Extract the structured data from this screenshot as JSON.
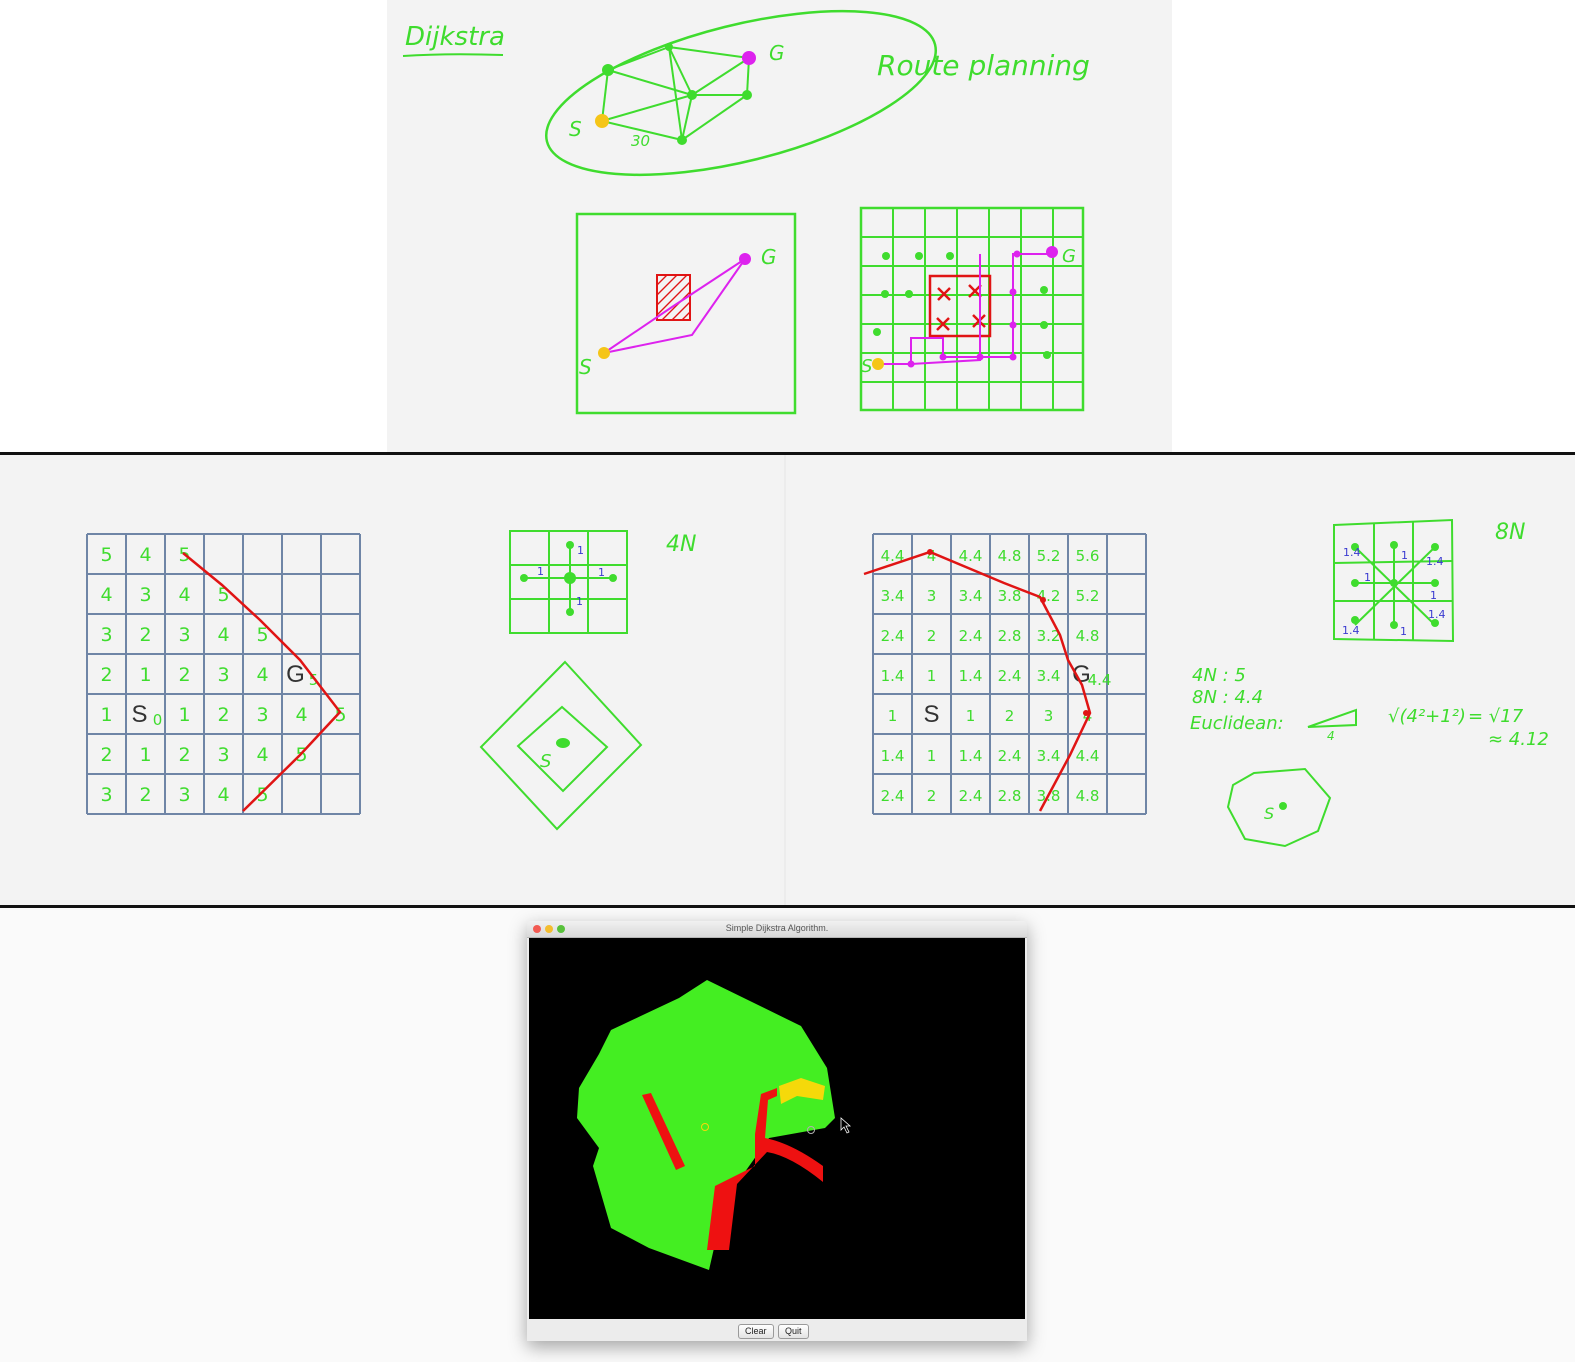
{
  "top_panel": {
    "title": "Dijkstra",
    "heading": "Route planning",
    "graph_labels": {
      "start": "S",
      "goal": "G",
      "edge_weight": "30"
    },
    "obstacle_labels": {
      "start": "S",
      "goal": "G"
    },
    "grid_labels": {
      "start": "S",
      "goal": "G"
    }
  },
  "middle_panel": {
    "four_n": {
      "label": "4N",
      "grid": [
        [
          "5",
          "4",
          "5",
          "",
          "",
          "",
          ""
        ],
        [
          "4",
          "3",
          "4",
          "5",
          "",
          "",
          ""
        ],
        [
          "3",
          "2",
          "3",
          "4",
          "5",
          "",
          ""
        ],
        [
          "2",
          "1",
          "2",
          "3",
          "4",
          "G5",
          ""
        ],
        [
          "1",
          "S0",
          "1",
          "2",
          "3",
          "4",
          "5"
        ],
        [
          "2",
          "1",
          "2",
          "3",
          "4",
          "5",
          ""
        ],
        [
          "3",
          "2",
          "3",
          "4",
          "5",
          "",
          ""
        ]
      ],
      "start_label": "S",
      "goal_label": "G",
      "neighbor_weight": "1",
      "diamond_label": "S"
    },
    "eight_n": {
      "label": "8N",
      "grid": [
        [
          "4.4",
          "4",
          "4.4",
          "4.8",
          "5.2",
          "5.6",
          ""
        ],
        [
          "3.4",
          "3",
          "3.4",
          "3.8",
          "4.2",
          "5.2",
          ""
        ],
        [
          "2.4",
          "2",
          "2.4",
          "2.8",
          "3.2",
          "4.8",
          ""
        ],
        [
          "1.4",
          "1",
          "1.4",
          "2.4",
          "3.4",
          "G4.4",
          ""
        ],
        [
          "1",
          "S",
          "1",
          "2",
          "3",
          "4",
          ""
        ],
        [
          "1.4",
          "1",
          "1.4",
          "2.4",
          "3.4",
          "4.4",
          ""
        ],
        [
          "2.4",
          "2",
          "2.4",
          "2.8",
          "3.8",
          "4.8",
          ""
        ]
      ],
      "start_label": "S",
      "goal_label": "G",
      "diag_weight": "1.4",
      "straight_weight": "1",
      "notes": [
        "4N : 5",
        "8N : 4.4",
        "Euclidean:"
      ],
      "triangle_base": "4",
      "formula_left": "√(4²+1²)",
      "formula_eq": "= √17",
      "formula_approx": "≈ 4.12",
      "octagon_label": "S"
    }
  },
  "app_window": {
    "title": "Simple Dijkstra Algorithm.",
    "buttons": {
      "clear": "Clear",
      "quit": "Quit"
    },
    "colors": {
      "background": "#000000",
      "visited": "#44ee22",
      "obstacle": "#ee1111",
      "frontier": "#f5d90a"
    }
  }
}
